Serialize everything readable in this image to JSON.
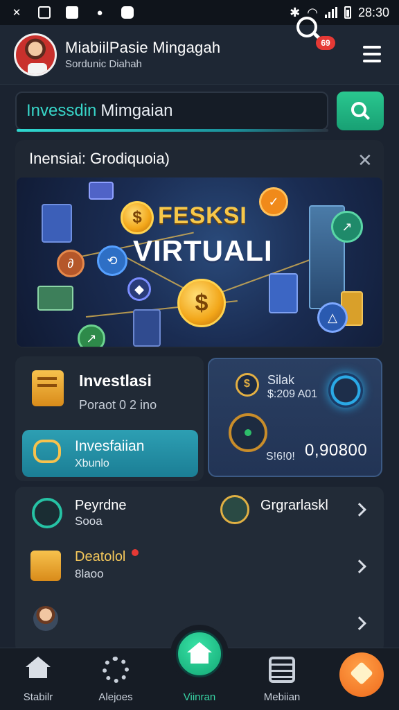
{
  "status_bar": {
    "time": "28:30",
    "left_icons": [
      "scissors-icon",
      "picture-icon",
      "flag-icon",
      "chat-icon",
      "mail-icon"
    ],
    "right_icons": [
      "bluetooth-icon",
      "wifi-icon",
      "signal-icon",
      "battery-icon"
    ]
  },
  "header": {
    "title": "MiabiilPasie Mingagah",
    "subtitle": "Sordunic Diahah",
    "notification_count": "69"
  },
  "search": {
    "value_highlight": "Invessdin",
    "value_rest": "Mimgaian"
  },
  "featured": {
    "title": "Inensiai: Grodiquoia)",
    "banner_line1": "FESKSI",
    "banner_line2": "VIRTUALI",
    "coin_symbol": "$"
  },
  "investment_card": {
    "title": "Investlasi",
    "subtitle": "Poraot 0 2 ino",
    "button_title": "Invesfaiian",
    "button_subtitle": "Xbunlo"
  },
  "balance_card": {
    "title": "Silak",
    "small_value": "$:209 A01",
    "label": "S!6!0!",
    "amount": "0,90800"
  },
  "list": {
    "items": [
      {
        "title": "Peyrdne",
        "subtitle": "Sooa"
      },
      {
        "title": "Grgrarlaskl",
        "subtitle": ""
      },
      {
        "title": "Deatolol",
        "subtitle": "8laoo"
      },
      {
        "title": "",
        "subtitle": ""
      }
    ]
  },
  "bottom_nav": {
    "items": [
      {
        "label": "Stabilr"
      },
      {
        "label": "Alejoes"
      },
      {
        "label": "Viinran"
      },
      {
        "label": "Mebiian"
      }
    ]
  },
  "colors": {
    "accent_teal": "#2fd7cf",
    "accent_green": "#18a074",
    "accent_orange": "#ef6a1c",
    "background": "#1b2330"
  }
}
